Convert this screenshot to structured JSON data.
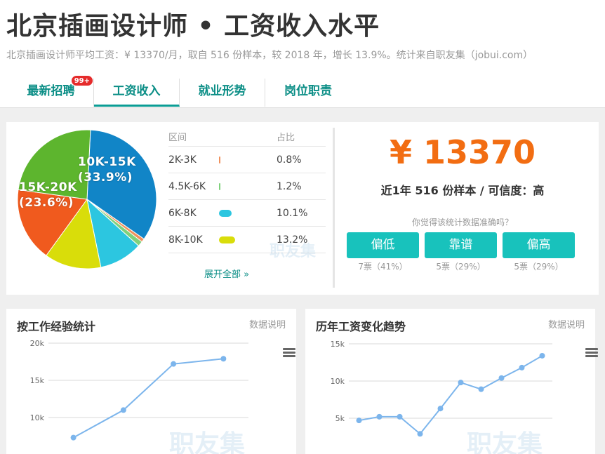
{
  "header": {
    "title": "北京插画设计师 • 工资收入水平",
    "subtitle": "北京插画设计师平均工资：¥ 13370/月，取自 516 份样本，较 2018 年，增长 13.9%。统计来自职友集（jobui.com）",
    "tabs": [
      {
        "label": "最新招聘",
        "badge": "99+",
        "active": false
      },
      {
        "label": "工资收入",
        "active": true
      },
      {
        "label": "就业形势",
        "active": false
      },
      {
        "label": "岗位职责",
        "active": false
      }
    ]
  },
  "distribution": {
    "header_range": "区间",
    "header_pct": "占比",
    "rows": [
      {
        "range": "2K-3K",
        "pct": "0.8%",
        "value": 0.8,
        "color": "#f0915c"
      },
      {
        "range": "4.5K-6K",
        "pct": "1.2%",
        "value": 1.2,
        "color": "#7fd17c"
      },
      {
        "range": "6K-8K",
        "pct": "10.1%",
        "value": 10.1,
        "color": "#2cc6e0"
      },
      {
        "range": "8K-10K",
        "pct": "13.2%",
        "value": 13.2,
        "color": "#d9dd0a"
      }
    ],
    "expand_label": "展开全部 »",
    "watermark": "职友集"
  },
  "pie": {
    "labels": [
      {
        "text": "10K-15K\n(33.9%)"
      },
      {
        "text": "15K-20K\n(23.6%)"
      }
    ],
    "slices": [
      {
        "label": "10K-15K",
        "value": 33.9,
        "color": "#1185c7"
      },
      {
        "label": "2K-3K",
        "value": 0.8,
        "color": "#f0915c"
      },
      {
        "label": "4.5K-6K",
        "value": 1.2,
        "color": "#7fd17c"
      },
      {
        "label": "6K-8K",
        "value": 10.1,
        "color": "#2cc6e0"
      },
      {
        "label": "8K-10K",
        "value": 13.2,
        "color": "#d9dd0a"
      },
      {
        "label": "other",
        "value": 17.2,
        "color": "#f05a1e"
      },
      {
        "label": "15K-20K",
        "value": 23.6,
        "color": "#5db52e"
      }
    ]
  },
  "summary": {
    "salary": "¥ 13370",
    "sample_line": "近1年 516 份样本 / 可信度：高",
    "question": "你觉得该统计数据准确吗？",
    "votes": [
      {
        "label": "偏低",
        "count": "7票（41%）"
      },
      {
        "label": "靠谱",
        "count": "5票（29%）"
      },
      {
        "label": "偏高",
        "count": "5票（29%）"
      }
    ]
  },
  "charts": {
    "experience": {
      "title": "按工作经验统计",
      "note": "数据说明",
      "watermark": "职友集"
    },
    "trend": {
      "title": "历年工资变化趋势",
      "note": "数据说明",
      "watermark": "职友集"
    }
  },
  "chart_data": [
    {
      "type": "line",
      "title": "按工作经验统计",
      "y_ticks": [
        "20k",
        "15k",
        "10k"
      ],
      "ylim": [
        5000,
        20000
      ],
      "values": [
        7300,
        11000,
        17200,
        17900
      ],
      "color": "#7cb5ec"
    },
    {
      "type": "line",
      "title": "历年工资变化趋势",
      "y_ticks": [
        "15k",
        "10k",
        "5k"
      ],
      "ylim": [
        0,
        15000
      ],
      "values": [
        4700,
        5200,
        5200,
        2900,
        6300,
        9800,
        8900,
        10400,
        11800,
        13400
      ],
      "color": "#7cb5ec"
    }
  ]
}
